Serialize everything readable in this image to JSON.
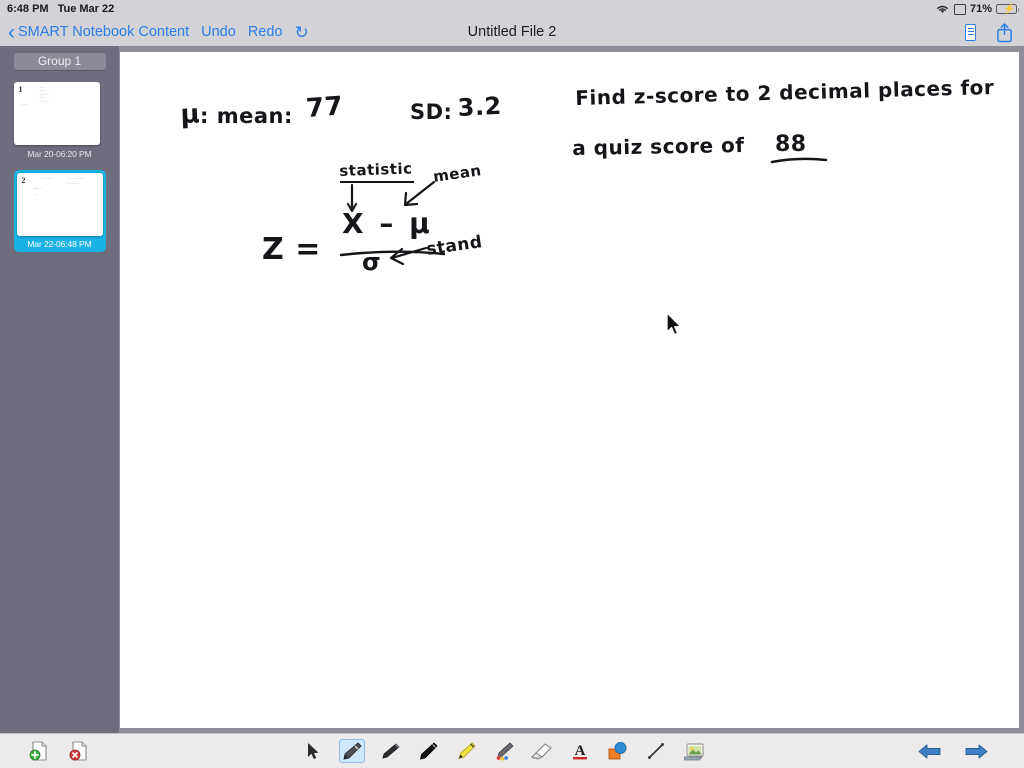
{
  "statusbar": {
    "time": "6:48 PM",
    "date": "Tue Mar 22",
    "battery_pct": "71%",
    "wifi_icon": "wifi-icon",
    "display_icon": "display-icon",
    "battery_icon": "battery-charging-icon"
  },
  "navbar": {
    "back_label": "SMART Notebook Content",
    "undo_label": "Undo",
    "redo_label": "Redo",
    "refresh_icon": "refresh-icon",
    "title": "Untitled File 2",
    "device_icon": "device-icon",
    "share_icon": "share-icon"
  },
  "sidebar": {
    "group_label": "Group 1",
    "pages": [
      {
        "number": "1",
        "label": "Mar 20-06:20 PM",
        "selected": false
      },
      {
        "number": "2",
        "label": "Mar 22-06:48 PM",
        "selected": true
      }
    ]
  },
  "canvas": {
    "ink": {
      "mu_symbol": "μ",
      "mean_line": ": mean:",
      "mean_value": "77",
      "sd_label": "SD:",
      "sd_value": "3.2",
      "question_line1": "Find z-score to 2 decimal places for",
      "question_line2_pre": "a quiz score of",
      "question_value": "88",
      "annotation_statistic": "statistic",
      "annotation_mean": "mean",
      "annotation_stand": "stand",
      "formula_z": "Z =",
      "formula_numerator": "X – μ",
      "formula_denominator": "σ"
    },
    "cursor_icon": "mouse-pointer-icon",
    "cursor_x": "552",
    "cursor_y": "268"
  },
  "toolbar": {
    "add_page_label": "add-page",
    "delete_page_label": "delete-page",
    "tools": [
      {
        "name": "select-tool",
        "icon": "cursor-icon",
        "active": false
      },
      {
        "name": "pen-tool",
        "icon": "pen-icon",
        "active": true
      },
      {
        "name": "calligraphy-pen",
        "icon": "calligraphy-pen-icon",
        "active": false
      },
      {
        "name": "marker-pen",
        "icon": "marker-pen-icon",
        "active": false
      },
      {
        "name": "highlighter",
        "icon": "highlighter-icon",
        "active": false
      },
      {
        "name": "creative-pen",
        "icon": "creative-pen-icon",
        "active": false
      },
      {
        "name": "eraser-tool",
        "icon": "eraser-icon",
        "active": false
      },
      {
        "name": "text-tool",
        "icon": "text-a-icon",
        "active": false
      },
      {
        "name": "shapes-tool",
        "icon": "shapes-icon",
        "active": false
      },
      {
        "name": "line-tool",
        "icon": "line-icon",
        "active": false
      },
      {
        "name": "gallery-tool",
        "icon": "gallery-image-icon",
        "active": false
      }
    ],
    "prev_page_icon": "arrow-left-icon",
    "next_page_icon": "arrow-right-icon"
  },
  "colors": {
    "accent_blue": "#2d7fe8",
    "selection_cyan": "#19b2e5",
    "sidebar_gray": "#6d6d7d",
    "toolbar_gray": "#eceaea",
    "battery_green": "#3cc93c"
  }
}
